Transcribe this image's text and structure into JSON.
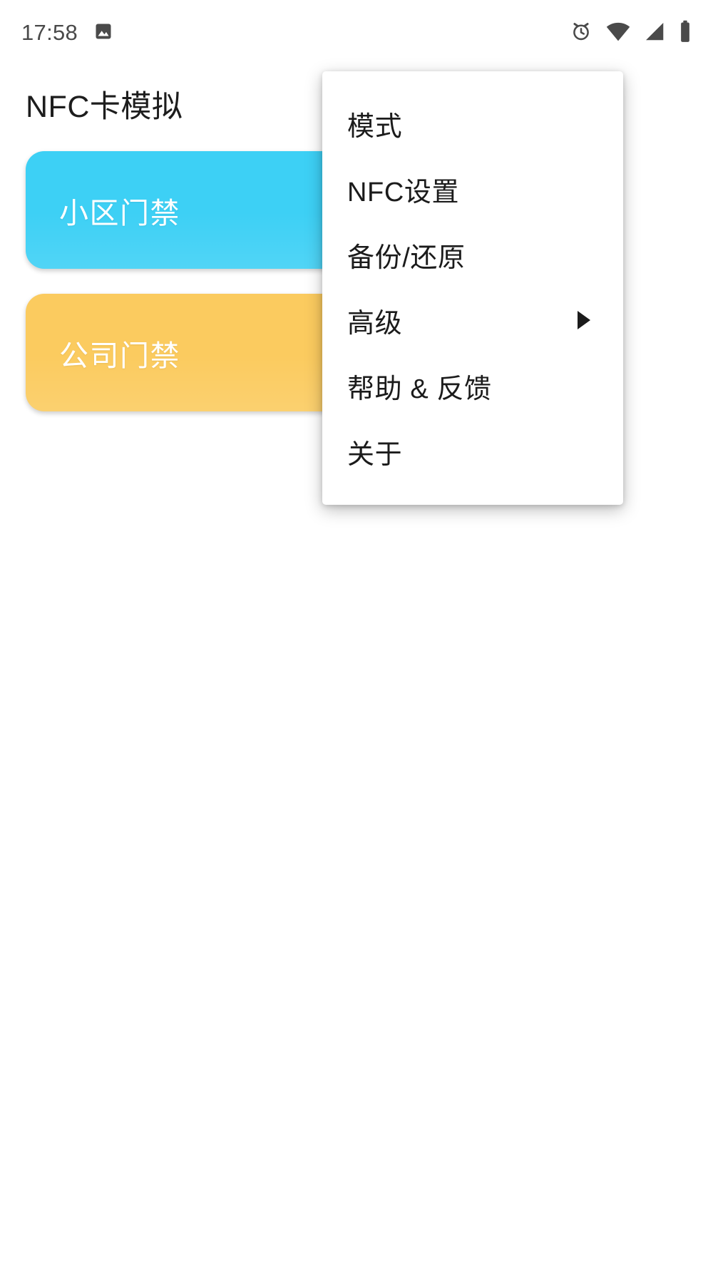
{
  "status_bar": {
    "time": "17:58",
    "left_icons": [
      {
        "name": "image-icon",
        "label": "image"
      }
    ],
    "right_icons": [
      {
        "name": "alarm-clock-icon",
        "label": "alarm"
      },
      {
        "name": "wifi-icon",
        "label": "wifi"
      },
      {
        "name": "cellular-signal-icon",
        "label": "signal"
      },
      {
        "name": "battery-icon",
        "label": "battery"
      }
    ]
  },
  "header": {
    "title": "NFC卡模拟"
  },
  "cards": [
    {
      "label": "小区门禁",
      "color": "#3DD0F5"
    },
    {
      "label": "公司门禁",
      "color": "#FBCB5F"
    }
  ],
  "menu": {
    "items": [
      {
        "label": "模式",
        "has_submenu": false
      },
      {
        "label": "NFC设置",
        "has_submenu": false
      },
      {
        "label": "备份/还原",
        "has_submenu": false
      },
      {
        "label": "高级",
        "has_submenu": true
      },
      {
        "label": "帮助 & 反馈",
        "has_submenu": false
      },
      {
        "label": "关于",
        "has_submenu": false
      }
    ]
  },
  "colors": {
    "card_blue": "#3DD0F5",
    "card_yellow": "#FBCB5F",
    "text_primary": "#1B1B1B",
    "status_icon": "#4A4A4A",
    "background": "#FFFFFF"
  }
}
